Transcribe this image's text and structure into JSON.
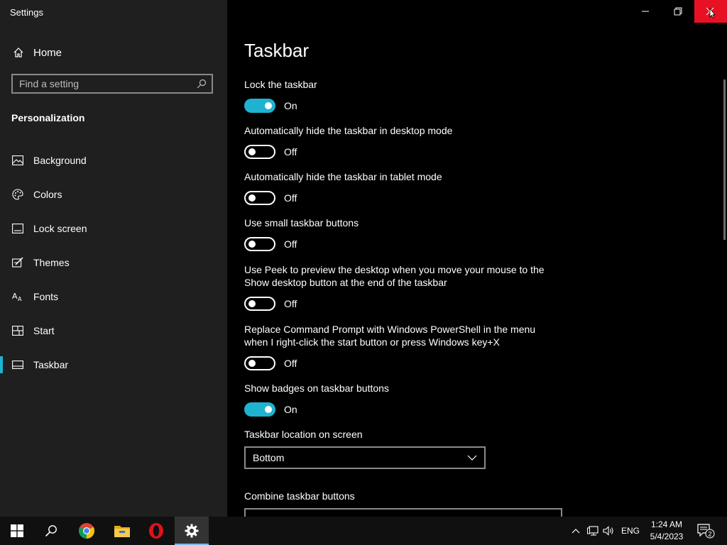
{
  "window": {
    "title": "Settings"
  },
  "sidebar": {
    "home_label": "Home",
    "search_placeholder": "Find a setting",
    "section_title": "Personalization",
    "items": [
      {
        "label": "Background",
        "icon": "image-icon",
        "active": false
      },
      {
        "label": "Colors",
        "icon": "palette-icon",
        "active": false
      },
      {
        "label": "Lock screen",
        "icon": "lock-screen-icon",
        "active": false
      },
      {
        "label": "Themes",
        "icon": "themes-icon",
        "active": false
      },
      {
        "label": "Fonts",
        "icon": "fonts-icon",
        "active": false
      },
      {
        "label": "Start",
        "icon": "start-icon",
        "active": false
      },
      {
        "label": "Taskbar",
        "icon": "taskbar-icon",
        "active": true
      }
    ]
  },
  "main": {
    "title": "Taskbar",
    "settings": [
      {
        "label": "Lock the taskbar",
        "state": "On"
      },
      {
        "label": "Automatically hide the taskbar in desktop mode",
        "state": "Off"
      },
      {
        "label": "Automatically hide the taskbar in tablet mode",
        "state": "Off"
      },
      {
        "label": "Use small taskbar buttons",
        "state": "Off"
      },
      {
        "label": "Use Peek to preview the desktop when you move your mouse to the Show desktop button at the end of the taskbar",
        "state": "Off"
      },
      {
        "label": "Replace Command Prompt with Windows PowerShell in the menu when I right-click the start button or press Windows key+X",
        "state": "Off"
      },
      {
        "label": "Show badges on taskbar buttons",
        "state": "On"
      }
    ],
    "location_label": "Taskbar location on screen",
    "location_value": "Bottom",
    "combine_label": "Combine taskbar buttons"
  },
  "taskbar": {
    "language": "ENG",
    "time": "1:24 AM",
    "date": "5/4/2023",
    "notification_count": "2"
  },
  "colors": {
    "accent": "#1fb3d1",
    "close_hover": "#e81123"
  }
}
